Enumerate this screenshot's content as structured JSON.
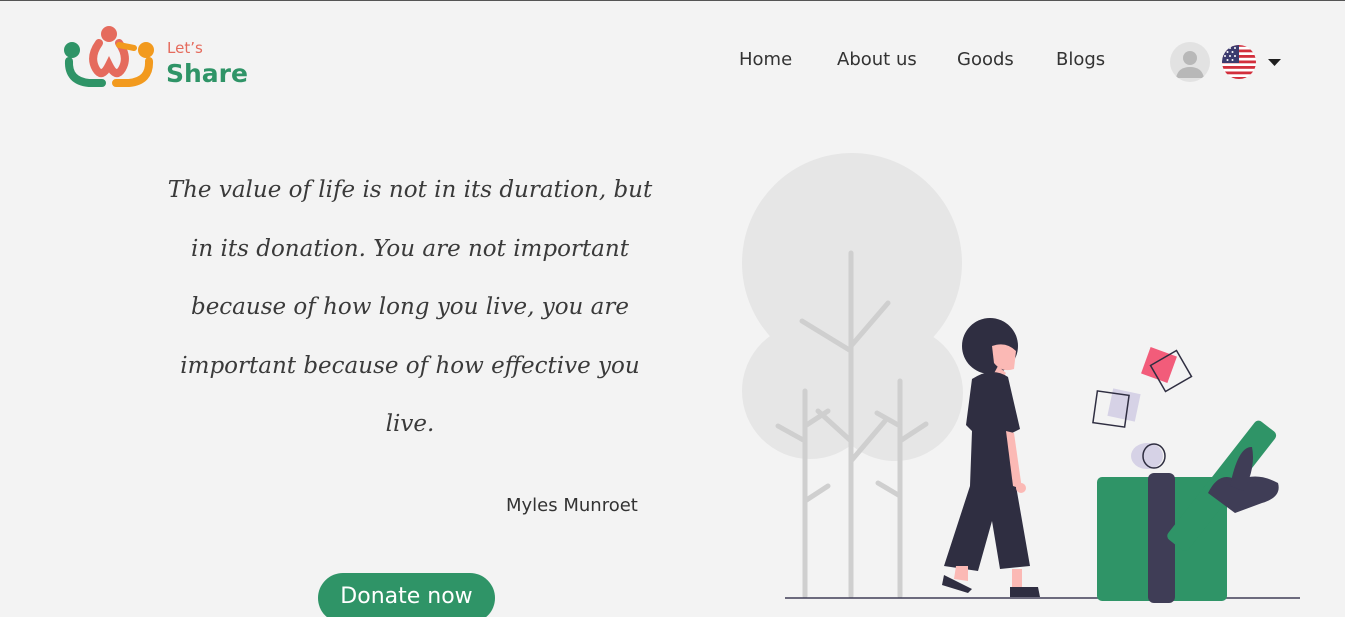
{
  "brand": {
    "line1": "Let’s",
    "line2": "Share"
  },
  "nav": {
    "items": [
      "Home",
      "About us",
      "Goods",
      "Blogs"
    ]
  },
  "user": {
    "avatar_icon": "user-avatar-icon",
    "language_flag": "us-flag-icon",
    "language_caret": "caret-down-icon"
  },
  "hero": {
    "quote": "The value of life is not in its duration, but in its donation. You are not important because of how long you live, you are important because of how effective you live.",
    "author": "Myles Munroet",
    "cta_label": "Donate now"
  },
  "colors": {
    "brand_green": "#2f9467",
    "brand_coral": "#e56b5d",
    "brand_orange": "#f29a1e",
    "background": "#f3f3f3",
    "dark": "#2f2e41",
    "gift_pink": "#f25c7a"
  }
}
